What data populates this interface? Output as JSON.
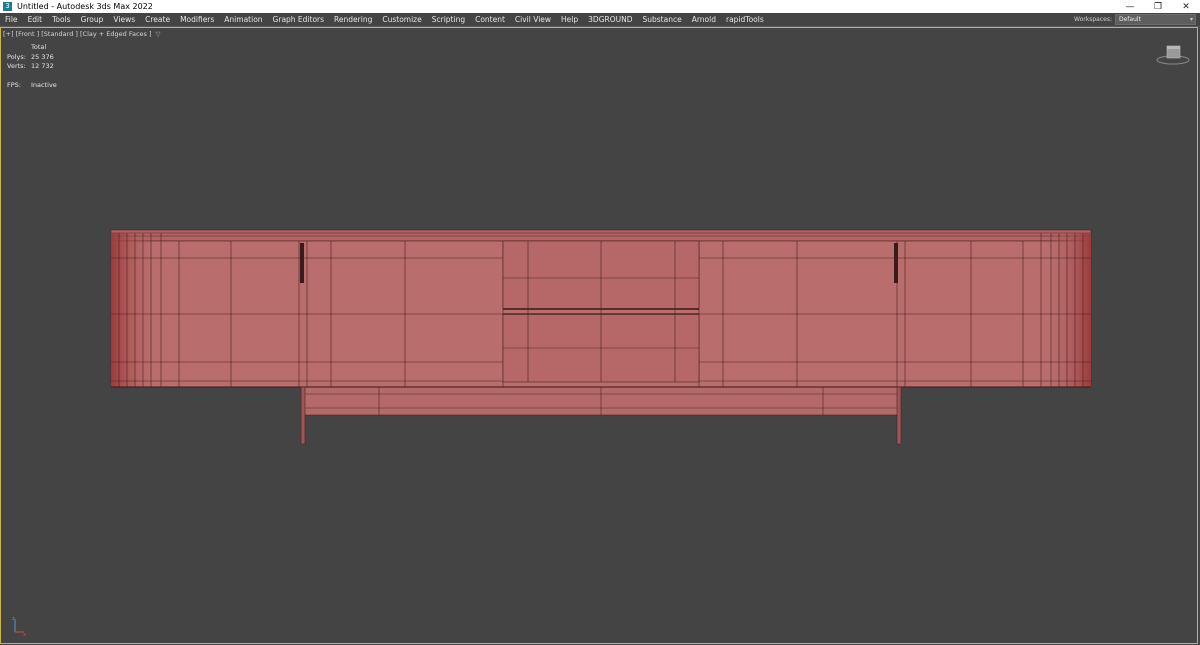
{
  "titlebar": {
    "title": "Untitled - Autodesk 3ds Max 2022",
    "icon": "3dsmax-app-icon",
    "controls": [
      "minimize",
      "restore",
      "close"
    ]
  },
  "menubar": {
    "items": [
      "File",
      "Edit",
      "Tools",
      "Group",
      "Views",
      "Create",
      "Modifiers",
      "Animation",
      "Graph Editors",
      "Rendering",
      "Customize",
      "Scripting",
      "Content",
      "Civil View",
      "Help",
      "3DGROUND",
      "Substance",
      "Arnold",
      "rapidTools"
    ],
    "workspaces_label": "Workspaces:",
    "workspaces_value": "Default"
  },
  "viewport": {
    "label": "[+] [Front ] [Standard ] [Clay + Edged Faces ]",
    "stats": {
      "total_label": "Total",
      "polys_label": "Polys:",
      "polys_value": "25 376",
      "verts_label": "Verts:",
      "verts_value": "12 732",
      "fps_label": "FPS:",
      "fps_value": "Inactive"
    },
    "border_color": "#c9b548",
    "background_color": "#444444",
    "model_color": "#b86b6b"
  }
}
